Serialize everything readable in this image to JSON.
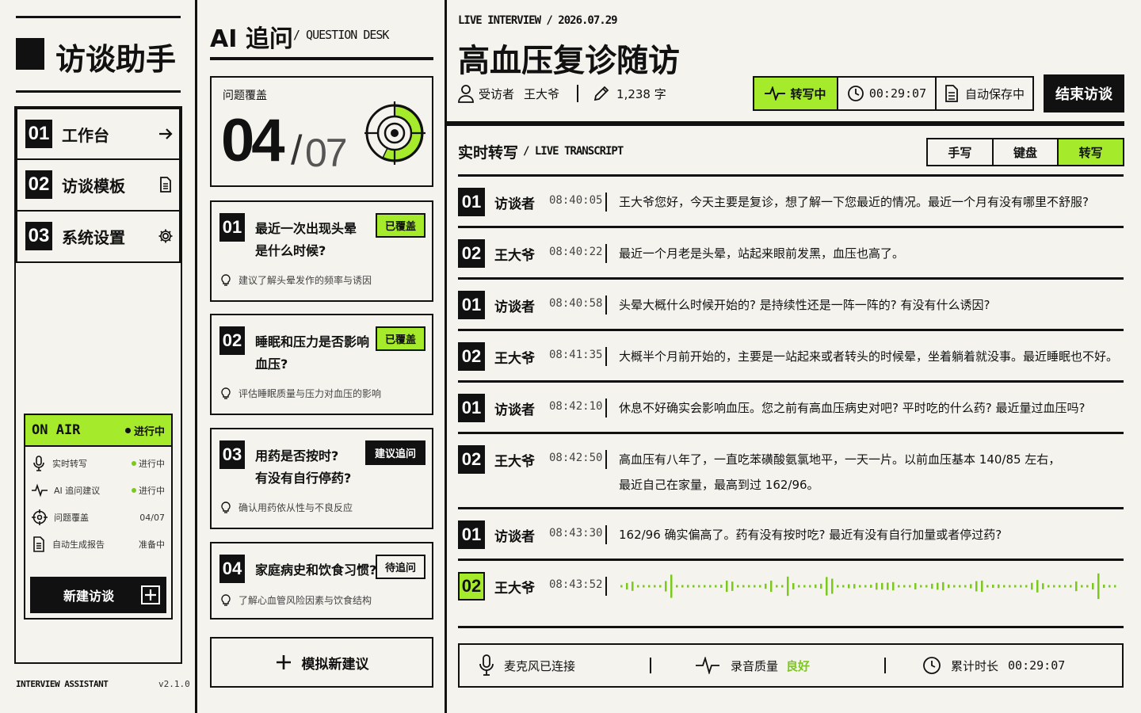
{
  "sidebar": {
    "app_title": "访谈助手",
    "nav": [
      {
        "num": "01",
        "label": "工作台",
        "icon": "arrow-right-icon"
      },
      {
        "num": "02",
        "label": "访谈模板",
        "icon": "document-icon"
      },
      {
        "num": "03",
        "label": "系统设置",
        "icon": "gear-icon"
      }
    ],
    "on_air": {
      "title": "ON AIR",
      "status": "进行中",
      "rows": [
        {
          "label": "实时转写",
          "value": "进行中",
          "icon": "microphone-icon"
        },
        {
          "label": "AI 追问建议",
          "value": "进行中",
          "icon": "pulse-icon"
        },
        {
          "label": "问题覆盖",
          "value": "04/07",
          "icon": "crosshair-icon"
        },
        {
          "label": "自动生成报告",
          "value": "准备中",
          "icon": "document-icon"
        }
      ],
      "new_button": "新建访谈"
    },
    "footer_left": "INTERVIEW ASSISTANT",
    "footer_right": "v2.1.0"
  },
  "questions": {
    "title": "AI 追问",
    "subtitle": "/ QUESTION DESK",
    "coverage_label": "问题覆盖",
    "coverage_done": "04",
    "coverage_sep": "/",
    "coverage_total": "07",
    "coverage_fraction": 0.571,
    "cards": [
      {
        "num": "01",
        "title_1": "最近一次出现头晕",
        "title_2": "是什么时候?",
        "tag": "已覆盖",
        "hint": "建议了解头晕发作的频率与诱因"
      },
      {
        "num": "02",
        "title_1": "睡眠和压力是否影响",
        "title_2": "血压?",
        "tag": "已覆盖",
        "hint": "评估睡眠质量与压力对血压的影响"
      },
      {
        "num": "03",
        "title_1": "用药是否按时?",
        "title_2": "有没有自行停药?",
        "tag": "建议追问",
        "hint": "确认用药依从性与不良反应"
      },
      {
        "num": "04",
        "title_1": "家庭病史和饮食习惯?",
        "title_2": "",
        "tag": "待追问",
        "hint": "了解心血管风险因素与饮食结构"
      }
    ],
    "simulate_button": "模拟新建议"
  },
  "header": {
    "eyebrow": "LIVE INTERVIEW / 2026.07.29",
    "title": "高血压复诊随访",
    "interviewee_label": "受访者",
    "interviewee_name": "王大爷",
    "word_count": "1,238 字",
    "status_transcribing": "转写中",
    "timer": "00:29:07",
    "autosave": "自动保存中",
    "end_button": "结束访谈"
  },
  "transcript": {
    "title": "实时转写",
    "subtitle": "/ LIVE TRANSCRIPT",
    "modes": [
      "手写",
      "键盘",
      "转写"
    ],
    "active_mode": "转写",
    "rows": [
      {
        "num": "01",
        "speaker": "访谈者",
        "time": "08:40:05",
        "text": "王大爷您好，今天主要是复诊，想了解一下您最近的情况。最近一个月有没有哪里不舒服?",
        "text2": ""
      },
      {
        "num": "02",
        "speaker": "王大爷",
        "time": "08:40:22",
        "text": "最近一个月老是头晕，站起来眼前发黑，血压也高了。",
        "text2": ""
      },
      {
        "num": "01",
        "speaker": "访谈者",
        "time": "08:40:58",
        "text": "头晕大概什么时候开始的? 是持续性还是一阵一阵的? 有没有什么诱因?",
        "text2": ""
      },
      {
        "num": "02",
        "speaker": "王大爷",
        "time": "08:41:35",
        "text": "大概半个月前开始的，主要是一站起来或者转头的时候晕，坐着躺着就没事。最近睡眠也不好。",
        "text2": ""
      },
      {
        "num": "01",
        "speaker": "访谈者",
        "time": "08:42:10",
        "text": "休息不好确实会影响血压。您之前有高血压病史对吧? 平时吃的什么药? 最近量过血压吗?",
        "text2": ""
      },
      {
        "num": "02",
        "speaker": "王大爷",
        "time": "08:42:50",
        "text": "高血压有八年了，一直吃苯磺酸氨氯地平，一天一片。以前血压基本 140/85 左右，",
        "text2": "最近自己在家量，最高到过 162/96。"
      },
      {
        "num": "01",
        "speaker": "访谈者",
        "time": "08:43:30",
        "text": "162/96 确实偏高了。药有没有按时吃? 最近有没有自行加量或者停过药?",
        "text2": ""
      }
    ],
    "live_row": {
      "num": "02",
      "speaker": "王大爷",
      "time": "08:43:52"
    }
  },
  "footer": {
    "mic_status": "麦克风已连接",
    "quality_label": "录音质量",
    "quality_value": "良好",
    "duration_label": "累计时长",
    "duration_value": "00:29:07"
  },
  "colors": {
    "accent": "#a6ea2c",
    "ink": "#111111",
    "paper": "#f4f3ee"
  }
}
